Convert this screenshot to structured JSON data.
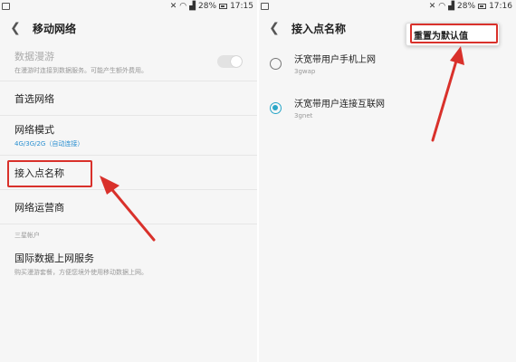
{
  "left": {
    "status": {
      "time": "17:15",
      "battery": "28%"
    },
    "title": "移动网络",
    "items": [
      {
        "title": "数据漫游",
        "sub": "在漫游时连接到数据服务。可能产生额外费用。",
        "disabled": true
      },
      {
        "title": "首选网络"
      },
      {
        "title": "网络模式",
        "sub": "4G/3G/2G（自动连接）"
      },
      {
        "title": "接入点名称"
      },
      {
        "title": "网络运营商"
      }
    ],
    "section": "三星帐户",
    "intl": {
      "title": "国际数据上网服务",
      "sub": "购买漫游套餐，方便您境外使用移动数据上网。"
    }
  },
  "right": {
    "status": {
      "time": "17:16",
      "battery": "28%"
    },
    "title": "接入点名称",
    "apns": [
      {
        "name": "沃宽带用户手机上网",
        "apn": "3gwap",
        "selected": false
      },
      {
        "name": "沃宽带用户连接互联网",
        "apn": "3gnet",
        "selected": true
      }
    ],
    "menu": {
      "reset": "重置为默认值"
    }
  },
  "colors": {
    "annotation": "#d9312b",
    "accent": "#2aa6c8",
    "link": "#2a8fd0"
  }
}
